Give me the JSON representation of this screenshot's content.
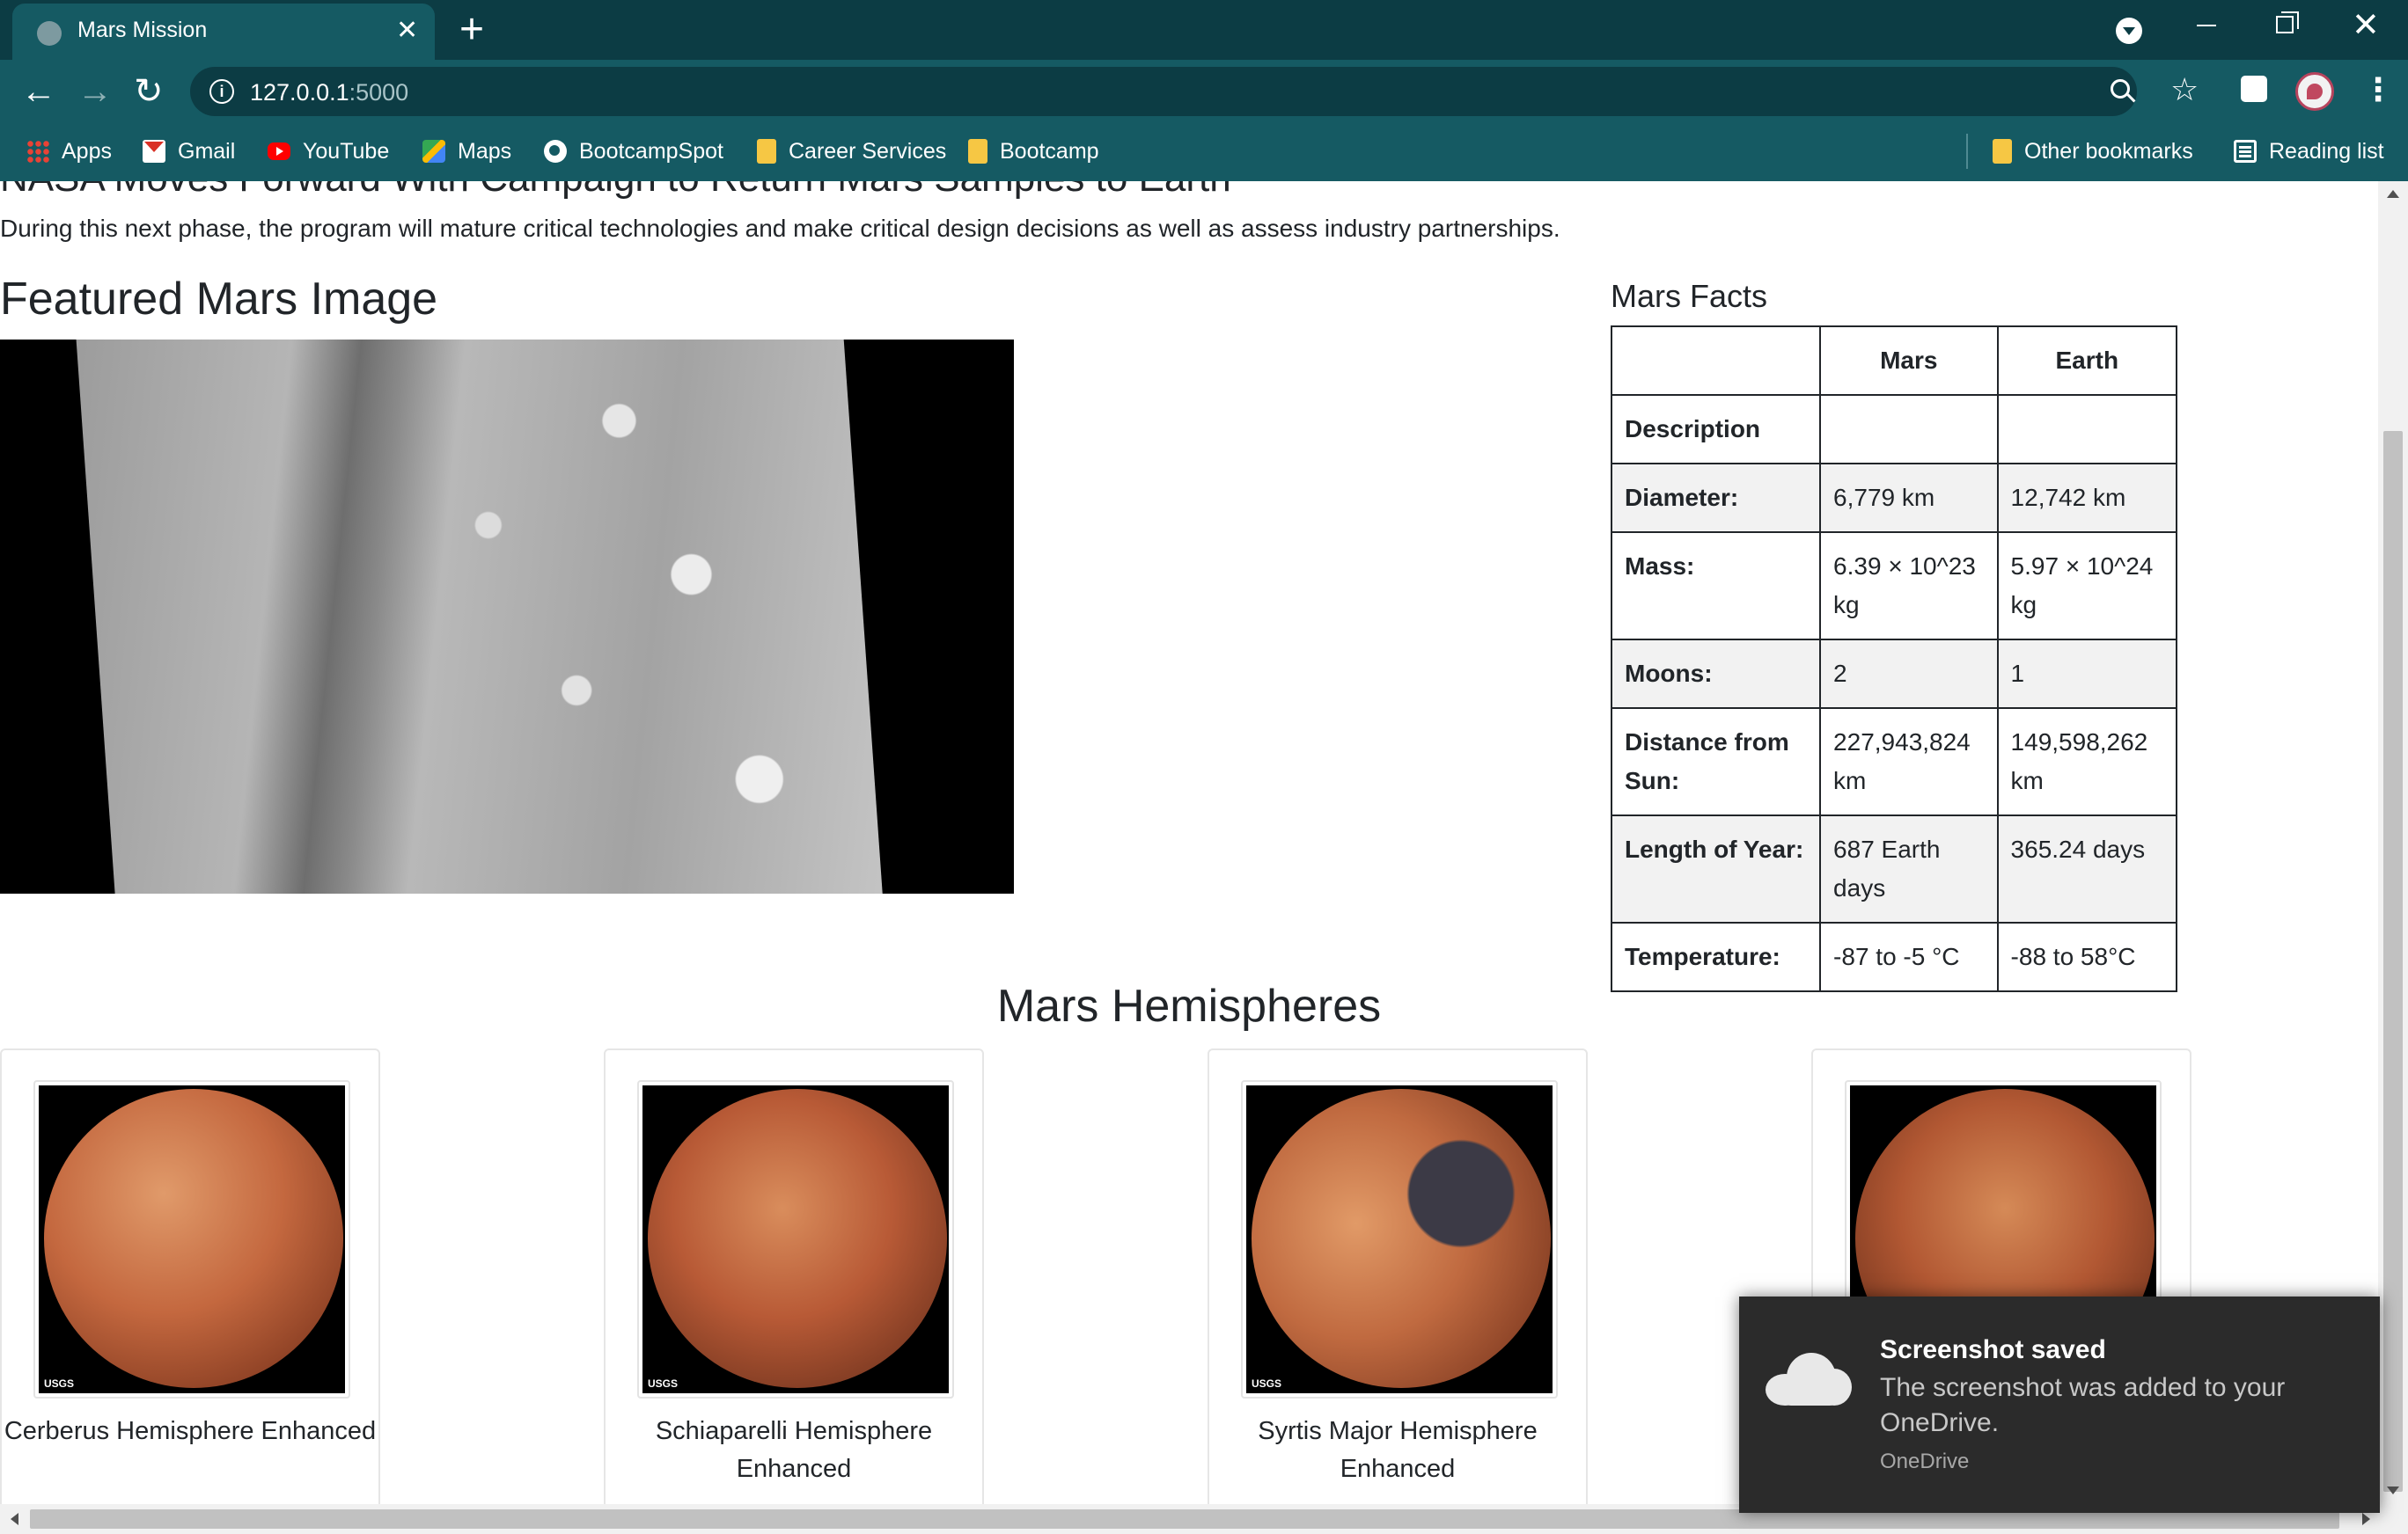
{
  "browser": {
    "tab_title": "Mars Mission",
    "tab_close": "✕",
    "new_tab": "+",
    "url_host": "127.0.0.1",
    "url_port": ":5000",
    "bookmarks": [
      {
        "label": "Apps",
        "icon": "apps-grid-icon"
      },
      {
        "label": "Gmail",
        "icon": "gmail-icon"
      },
      {
        "label": "YouTube",
        "icon": "youtube-icon"
      },
      {
        "label": "Maps",
        "icon": "maps-icon"
      },
      {
        "label": "BootcampSpot",
        "icon": "globe-icon"
      },
      {
        "label": "Career Services",
        "icon": "folder-icon"
      },
      {
        "label": "Bootcamp",
        "icon": "folder-icon"
      }
    ],
    "other_bookmarks": "Other bookmarks",
    "reading_list": "Reading list"
  },
  "news": {
    "title": "NASA Moves Forward With Campaign to Return Mars Samples to Earth",
    "paragraph": "During this next phase, the program will mature critical technologies and make critical design decisions as well as assess industry partnerships."
  },
  "featured": {
    "title": "Featured Mars Image"
  },
  "facts": {
    "title": "Mars Facts",
    "headers": [
      "",
      "Mars",
      "Earth"
    ],
    "rows": [
      {
        "label": "Description",
        "mars": "",
        "earth": ""
      },
      {
        "label": "Diameter:",
        "mars": "6,779 km",
        "earth": "12,742 km"
      },
      {
        "label": "Mass:",
        "mars": "6.39 × 10^23 kg",
        "earth": "5.97 × 10^24 kg"
      },
      {
        "label": "Moons:",
        "mars": "2",
        "earth": "1"
      },
      {
        "label": "Distance from Sun:",
        "mars": "227,943,824 km",
        "earth": "149,598,262 km"
      },
      {
        "label": "Length of Year:",
        "mars": "687 Earth days",
        "earth": "365.24 days"
      },
      {
        "label": "Temperature:",
        "mars": "-87 to -5 °C",
        "earth": "-88 to 58°C"
      }
    ]
  },
  "hemispheres": {
    "title": "Mars Hemispheres",
    "items": [
      {
        "title": "Cerberus Hemisphere Enhanced",
        "logo": "USGS"
      },
      {
        "title": "Schiaparelli Hemisphere Enhanced",
        "logo": "USGS"
      },
      {
        "title": "Syrtis Major Hemisphere Enhanced",
        "logo": "USGS"
      },
      {
        "title": "",
        "logo": ""
      }
    ]
  },
  "toast": {
    "heading": "Screenshot saved",
    "body": "The screenshot was added to your OneDrive.",
    "source": "OneDrive"
  }
}
